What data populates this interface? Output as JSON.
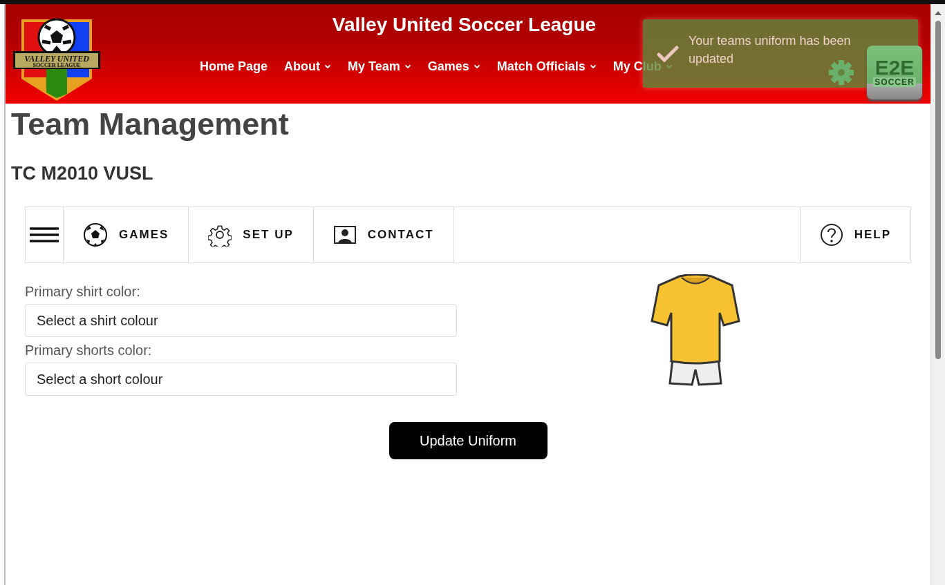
{
  "header": {
    "logo": {
      "line_1": "VALLEY UNITED",
      "line_2": "SOCCER LEAGUE"
    },
    "title": "Valley United Soccer League",
    "nav": [
      {
        "label": "Home Page",
        "dropdown": false
      },
      {
        "label": "About",
        "dropdown": true
      },
      {
        "label": "My Team",
        "dropdown": true
      },
      {
        "label": "Games",
        "dropdown": true
      },
      {
        "label": "Match Officials",
        "dropdown": true
      },
      {
        "label": "My Club",
        "dropdown": true
      }
    ]
  },
  "toast": {
    "message": "Your teams uniform has been updated"
  },
  "e2e_widget": {
    "line_1": "E2E",
    "line_2": "SOCCER"
  },
  "page": {
    "title": "Team Management",
    "team": "TC M2010 VUSL"
  },
  "tabs": [
    {
      "kind": "menu"
    },
    {
      "kind": "games",
      "label": "GAMES"
    },
    {
      "kind": "setup",
      "label": "SET UP"
    },
    {
      "kind": "contact",
      "label": "CONTACT"
    },
    {
      "kind": "spacer"
    },
    {
      "kind": "help",
      "label": "HELP"
    }
  ],
  "form": {
    "fields": [
      {
        "label": "Primary shirt color:",
        "placeholder": "Select a shirt colour"
      },
      {
        "label": "Primary shorts color:",
        "placeholder": "Select a short colour"
      }
    ],
    "button": "Update Uniform"
  }
}
